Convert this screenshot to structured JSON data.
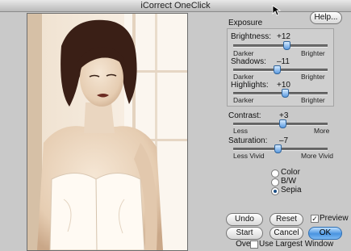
{
  "window": {
    "title": "iCorrect OneClick"
  },
  "help_label": "Help...",
  "exposure": {
    "title": "Exposure",
    "brightness": {
      "label": "Brightness:",
      "value": "+12",
      "level": 0.56,
      "left_label": "Darker",
      "right_label": "Brighter"
    },
    "shadows": {
      "label": "Shadows:",
      "value": "–11",
      "level": 0.46,
      "left_label": "Darker",
      "right_label": "Brighter"
    },
    "highlights": {
      "label": "Highlights:",
      "value": "+10",
      "level": 0.55,
      "left_label": "Darker",
      "right_label": "Brighter"
    }
  },
  "contrast": {
    "label": "Contrast:",
    "value": "+3",
    "level": 0.52,
    "left_label": "Less",
    "right_label": "More"
  },
  "saturation": {
    "label": "Saturation:",
    "value": "–7",
    "level": 0.47,
    "left_label": "Less Vivid",
    "right_label": "More Vivid"
  },
  "color_mode": {
    "options": [
      "Color",
      "B/W",
      "Sepia"
    ],
    "selected": "Sepia"
  },
  "buttons": {
    "undo": "Undo",
    "reset": "Reset",
    "start_over": "Start Over",
    "cancel": "Cancel",
    "ok": "OK"
  },
  "preview": {
    "label": "Preview",
    "checked": true
  },
  "use_largest_window": {
    "label": "Use Largest Window",
    "checked": false
  },
  "colors": {
    "accent": "#4a94e0",
    "sepia_light": "#f3e7d7",
    "sepia_dark": "#4a2a1e"
  }
}
